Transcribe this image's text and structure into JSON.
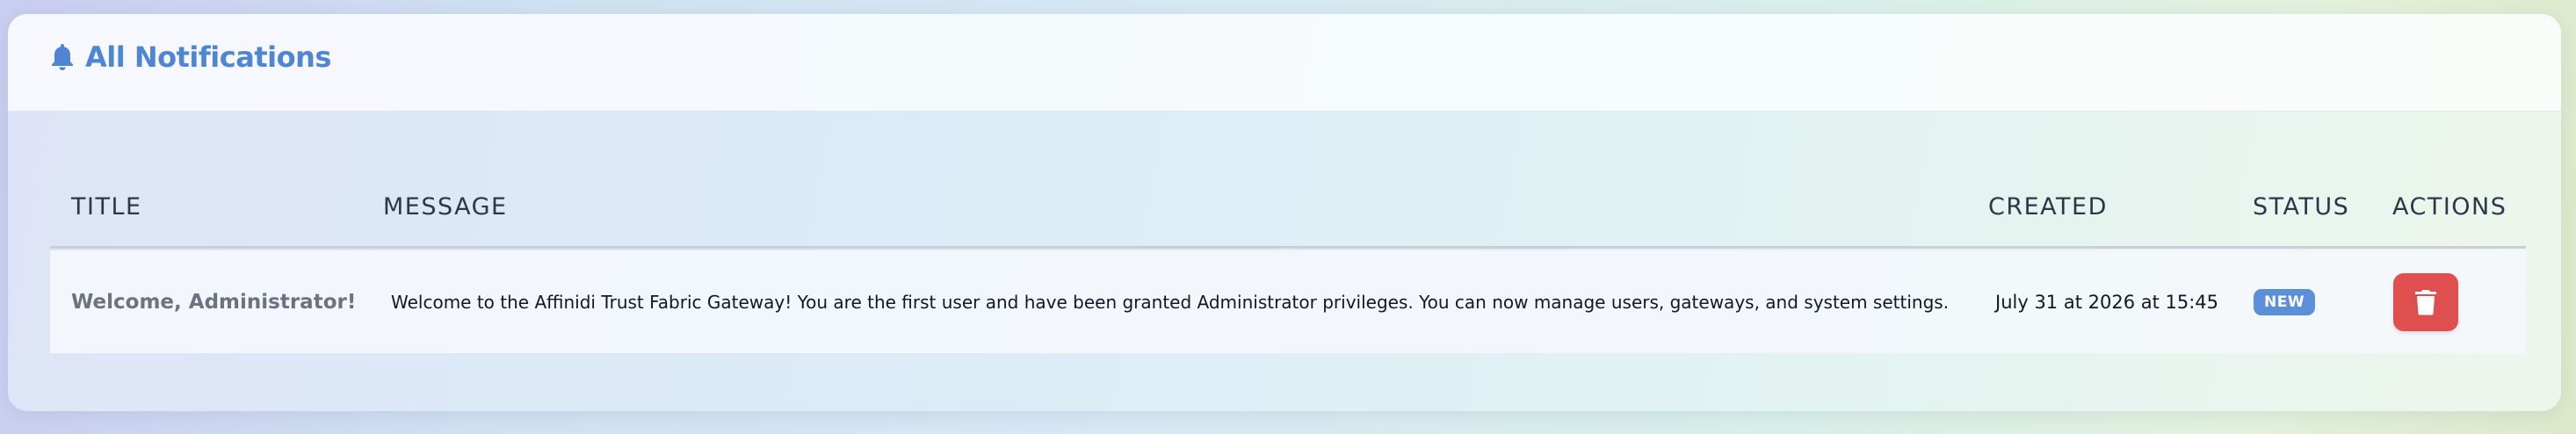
{
  "header": {
    "icon": "bell-icon",
    "title": "All Notifications"
  },
  "table": {
    "columns": [
      "TITLE",
      "MESSAGE",
      "CREATED",
      "STATUS",
      "ACTIONS"
    ],
    "rows": [
      {
        "title": "Welcome, Administrator!",
        "message": "Welcome to the Affinidi Trust Fabric Gateway! You are the first user and have been granted Administrator privileges. You can now manage users, gateways, and system settings.",
        "created": "July 31 at 2026 at 15:45",
        "status": "NEW",
        "action_icon": "trash-icon"
      }
    ]
  },
  "colors": {
    "accent": "#4f86d3",
    "badge": "#5b8fd9",
    "danger": "#e04f4f"
  }
}
